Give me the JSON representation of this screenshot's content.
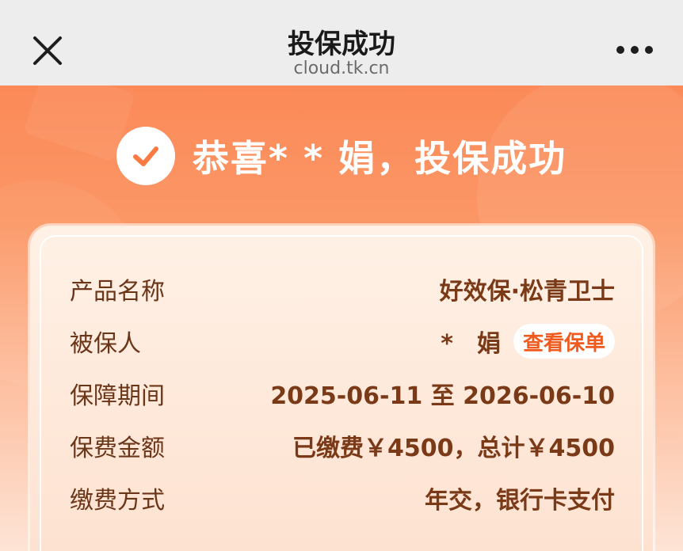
{
  "nav": {
    "title": "投保成功",
    "url": "cloud.tk.cn"
  },
  "success": {
    "message": "恭喜* * 娟，投保成功"
  },
  "policy": {
    "rows": [
      {
        "label": "产品名称",
        "value": "好效保·松青卫士"
      },
      {
        "label": "被保人",
        "value": "*　娟",
        "action": "查看保单"
      },
      {
        "label": "保障期间",
        "value": "2025-06-11 至 2026-06-10"
      },
      {
        "label": "保费金额",
        "value": "已缴费￥4500，总计￥4500"
      },
      {
        "label": "缴费方式",
        "value": "年交，银行卡支付"
      }
    ]
  },
  "colors": {
    "accent": "#fb8a58",
    "label": "#6b3518",
    "value": "#7a3a17",
    "action": "#f05a1e"
  },
  "icons": {
    "close": "close-icon",
    "more": "more-icon",
    "check": "check-circle-icon"
  }
}
